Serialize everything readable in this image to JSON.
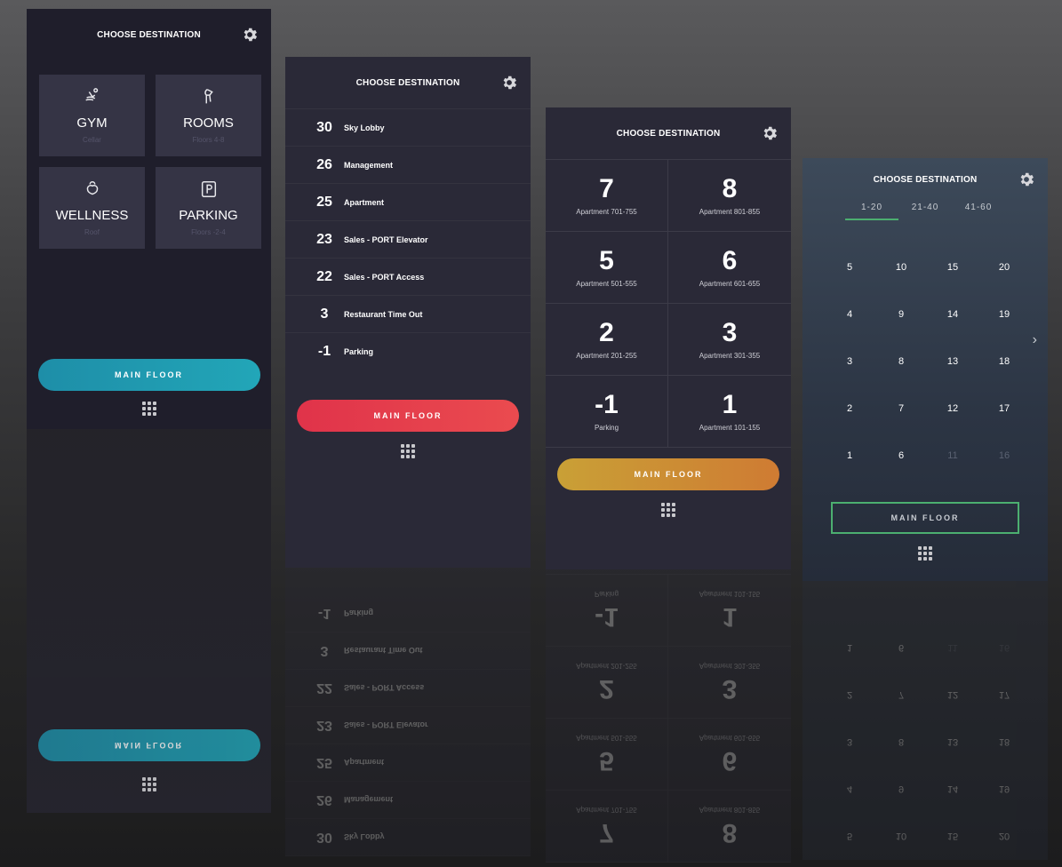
{
  "common": {
    "header_title": "CHOOSE DESTINATION",
    "main_floor_label": "MAIN FLOOR"
  },
  "panel1": {
    "accent": "#22a6b8",
    "tiles": [
      {
        "label": "GYM",
        "sub": "Cellar",
        "icon": "gym-icon"
      },
      {
        "label": "ROOMS",
        "sub": "Floors 4-8",
        "icon": "rooms-icon"
      },
      {
        "label": "WELLNESS",
        "sub": "Roof",
        "icon": "wellness-icon"
      },
      {
        "label": "PARKING",
        "sub": "Floors -2-4",
        "icon": "parking-icon"
      }
    ]
  },
  "panel2": {
    "accent": "#e0334a",
    "floors": [
      {
        "num": "30",
        "name": "Sky Lobby"
      },
      {
        "num": "26",
        "name": "Management"
      },
      {
        "num": "25",
        "name": "Apartment"
      },
      {
        "num": "23",
        "name": "Sales - PORT Elevator"
      },
      {
        "num": "22",
        "name": "Sales - PORT Access"
      },
      {
        "num": "3",
        "name": "Restaurant Time Out"
      },
      {
        "num": "-1",
        "name": "Parking"
      }
    ]
  },
  "panel3": {
    "accent": "#cf7b33",
    "cells": [
      {
        "num": "7",
        "label": "Apartment 701-755"
      },
      {
        "num": "8",
        "label": "Apartment 801-855"
      },
      {
        "num": "5",
        "label": "Apartment 501-555"
      },
      {
        "num": "6",
        "label": "Apartment 601-655"
      },
      {
        "num": "2",
        "label": "Apartment 201-255"
      },
      {
        "num": "3",
        "label": "Apartment 301-355"
      },
      {
        "num": "-1",
        "label": "Parking"
      },
      {
        "num": "1",
        "label": "Apartment 101-155"
      }
    ]
  },
  "panel4": {
    "accent": "#4caf70",
    "tabs": [
      "1-20",
      "21-40",
      "41-60"
    ],
    "active_tab": "1-20",
    "rows": [
      [
        "5",
        "10",
        "15",
        "20"
      ],
      [
        "4",
        "9",
        "14",
        "19"
      ],
      [
        "3",
        "8",
        "13",
        "18"
      ],
      [
        "2",
        "7",
        "12",
        "17"
      ],
      [
        "1",
        "6",
        "11",
        "16"
      ]
    ],
    "dim_numbers": [
      "11",
      "16"
    ],
    "next_arrow": "›"
  }
}
